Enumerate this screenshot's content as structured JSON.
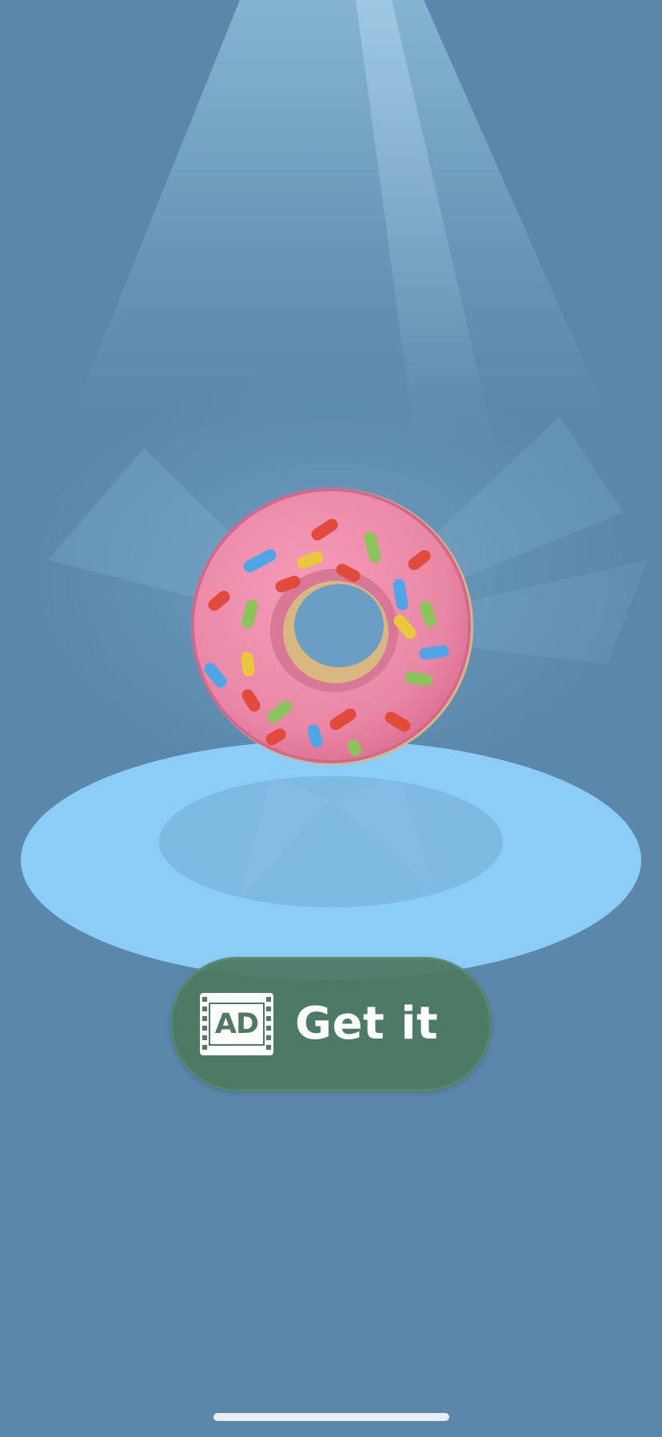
{
  "scene": {
    "item_name": "donut",
    "background_color": "#5a87aa",
    "pedestal_color": "#8ccdf8",
    "donut_frosting_color": "#ec88a8",
    "donut_dough_color": "#d8b880",
    "sprinkle_colors": [
      "#e24a3c",
      "#4ea6e6",
      "#e9c83c",
      "#8cc45c"
    ]
  },
  "button": {
    "label": "Get it",
    "ad_badge": "AD",
    "icon": "ad-video-icon",
    "color": "#4c7860"
  },
  "home_indicator": {
    "color": "#e9eef3"
  }
}
